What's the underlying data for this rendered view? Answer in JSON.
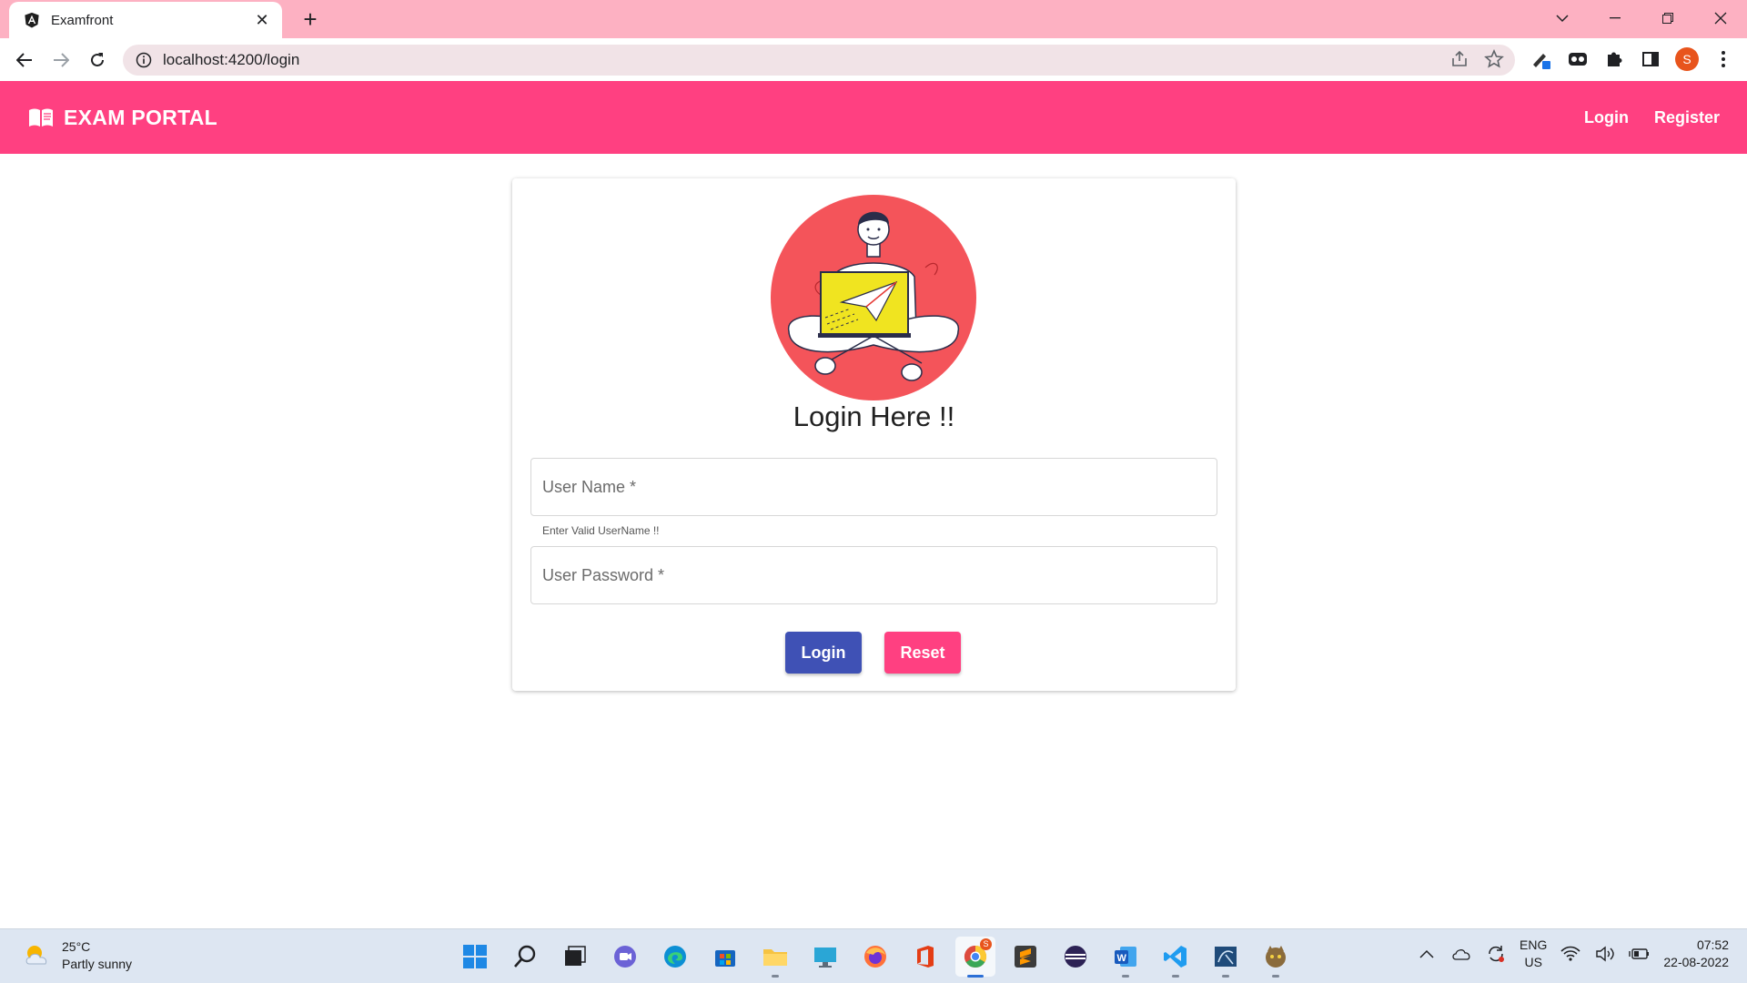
{
  "browser": {
    "tab_title": "Examfront",
    "url": "localhost:4200/login",
    "profile_initial": "S"
  },
  "navbar": {
    "brand": "EXAM PORTAL",
    "links": [
      "Login",
      "Register"
    ]
  },
  "login_card": {
    "title": "Login Here !!",
    "username_placeholder": "User Name *",
    "username_hint": "Enter Valid UserName !!",
    "password_placeholder": "User Password *",
    "login_label": "Login",
    "reset_label": "Reset"
  },
  "taskbar": {
    "temperature": "25°C",
    "weather": "Partly sunny",
    "chrome_badge": "S",
    "lang_primary": "ENG",
    "lang_secondary": "US",
    "time": "07:52",
    "date": "22-08-2022"
  },
  "colors": {
    "primary": "#ff4081",
    "accent": "#3f51b5",
    "tab_strip": "#fdb1c2"
  },
  "icons": {
    "browser": [
      "angular-icon",
      "close-icon",
      "plus-icon",
      "back-icon",
      "forward-icon",
      "reload-icon",
      "info-icon",
      "share-icon",
      "star-icon"
    ],
    "app": [
      "book-icon"
    ],
    "taskbar": [
      "windows-start-icon",
      "search-icon",
      "task-view-icon",
      "teams-icon",
      "edge-icon",
      "store-icon",
      "file-explorer-icon",
      "desktop-icon",
      "firefox-icon",
      "office-icon",
      "chrome-icon",
      "sublime-icon",
      "eclipse-icon",
      "word-icon",
      "vscode-icon",
      "mysql-icon",
      "tomcat-icon"
    ]
  }
}
